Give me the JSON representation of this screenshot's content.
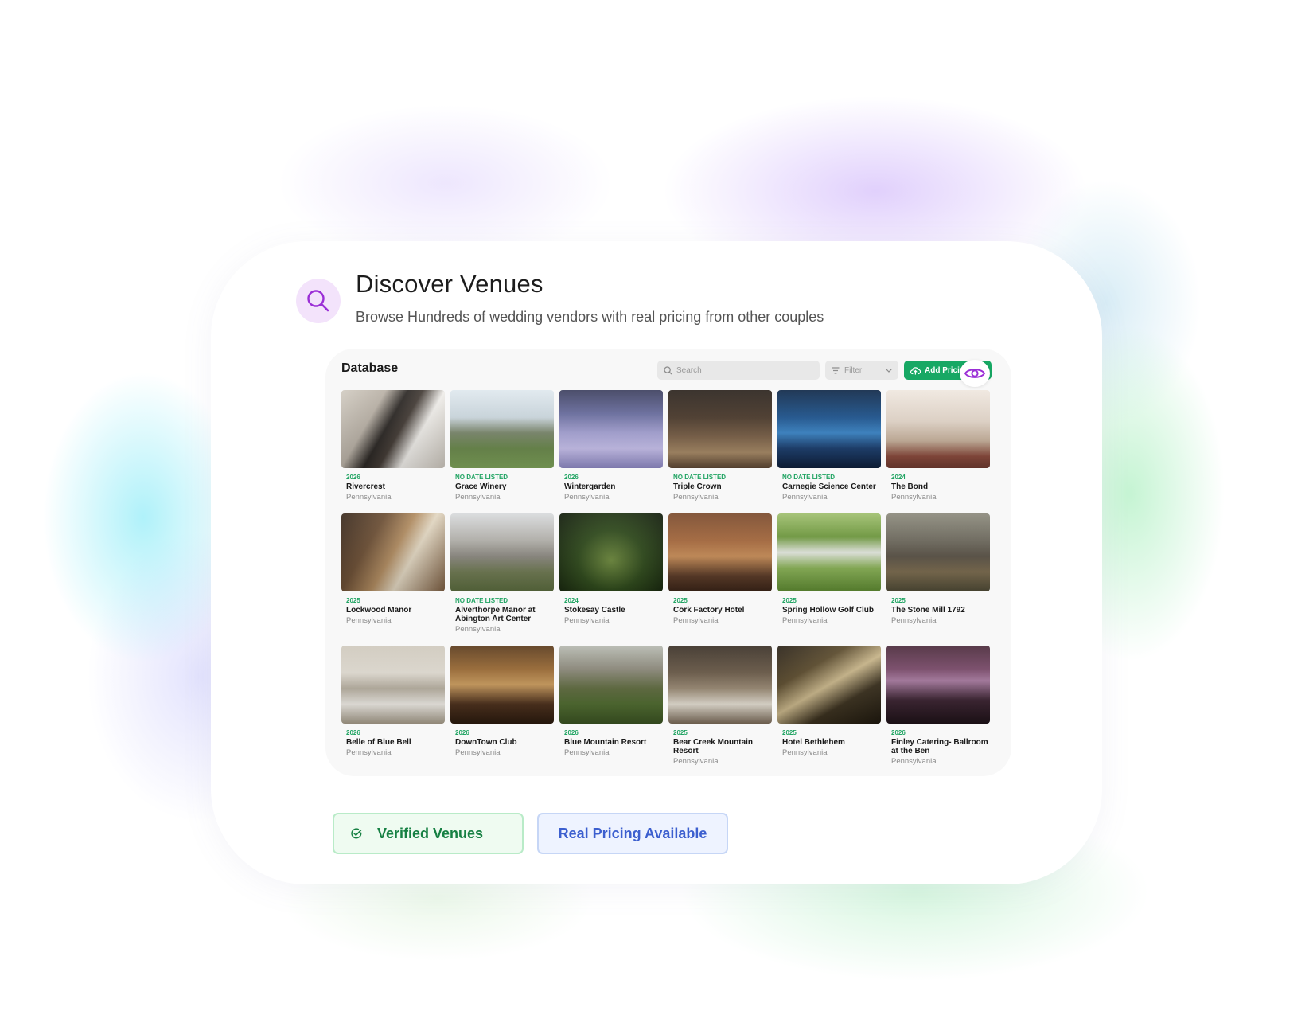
{
  "header": {
    "icon": "search-icon",
    "title": "Discover Venues",
    "subtitle": "Browse Hundreds of wedding vendors with real pricing from other couples"
  },
  "database": {
    "title": "Database",
    "search_placeholder": "Search",
    "filter_label": "Filter",
    "add_button_label": "Add Pricing"
  },
  "venues": [
    {
      "year": "2026",
      "name": "Rivercrest",
      "location": "Pennsylvania"
    },
    {
      "year": "NO DATE LISTED",
      "name": "Grace Winery",
      "location": "Pennsylvania"
    },
    {
      "year": "2026",
      "name": "Wintergarden",
      "location": "Pennsylvania"
    },
    {
      "year": "NO DATE LISTED",
      "name": "Triple Crown",
      "location": "Pennsylvania"
    },
    {
      "year": "NO DATE LISTED",
      "name": "Carnegie Science Center",
      "location": "Pennsylvania"
    },
    {
      "year": "2024",
      "name": "The Bond",
      "location": "Pennsylvania"
    },
    {
      "year": "2025",
      "name": "Lockwood Manor",
      "location": "Pennsylvania"
    },
    {
      "year": "NO DATE LISTED",
      "name": "Alverthorpe Manor at Abington Art Center",
      "location": "Pennsylvania"
    },
    {
      "year": "2024",
      "name": "Stokesay Castle",
      "location": "Pennsylvania"
    },
    {
      "year": "2025",
      "name": "Cork Factory Hotel",
      "location": "Pennsylvania"
    },
    {
      "year": "2025",
      "name": "Spring Hollow Golf Club",
      "location": "Pennsylvania"
    },
    {
      "year": "2025",
      "name": "The Stone Mill 1792",
      "location": "Pennsylvania"
    },
    {
      "year": "2026",
      "name": "Belle of Blue Bell",
      "location": "Pennsylvania"
    },
    {
      "year": "2026",
      "name": "DownTown Club",
      "location": "Pennsylvania"
    },
    {
      "year": "2026",
      "name": "Blue Mountain Resort",
      "location": "Pennsylvania"
    },
    {
      "year": "2025",
      "name": "Bear Creek Mountain Resort",
      "location": "Pennsylvania"
    },
    {
      "year": "2025",
      "name": "Hotel Bethlehem",
      "location": "Pennsylvania"
    },
    {
      "year": "2026",
      "name": "Finley Catering- Ballroom at the Ben",
      "location": "Pennsylvania"
    }
  ],
  "badges": {
    "verified_label": "Verified Venues",
    "pricing_label": "Real Pricing Available"
  },
  "colors": {
    "accent_purple": "#9b2fd6",
    "badge_bg": "#f3e3fb",
    "green": "#17a864",
    "verified_text": "#168043",
    "pricing_text": "#3c5fcf"
  }
}
